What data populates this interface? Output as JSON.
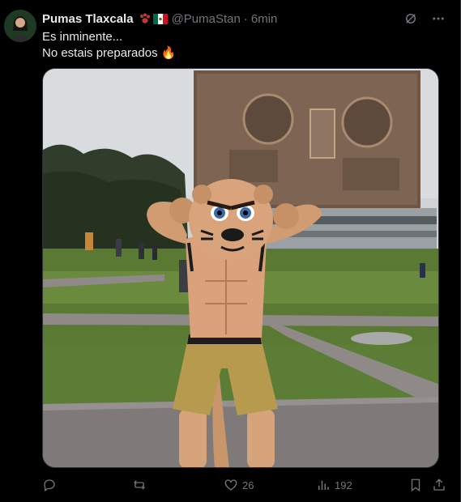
{
  "tweet": {
    "author_name": "Pumas Tlaxcala",
    "handle": "@PumaStan",
    "separator": "·",
    "time": "6min",
    "line1": "Es inminente...",
    "line2": "No estais preparados",
    "line2_emoji": "🔥"
  },
  "icons": {
    "flag1": "paw-print-emoji",
    "flag2": "mexico-flag-emoji",
    "grok": "grok-icon",
    "more": "more-options-icon",
    "reply": "reply-icon",
    "retweet": "retweet-icon",
    "like": "like-icon",
    "views": "views-icon",
    "bookmark": "bookmark-icon",
    "share": "share-icon"
  },
  "stats": {
    "reply_count": "",
    "retweet_count": "",
    "like_count": "26",
    "views_count": "192"
  },
  "colors": {
    "background": "#000000",
    "text_primary": "#e7e9ea",
    "text_secondary": "#71767b",
    "border": "#2f3336"
  }
}
